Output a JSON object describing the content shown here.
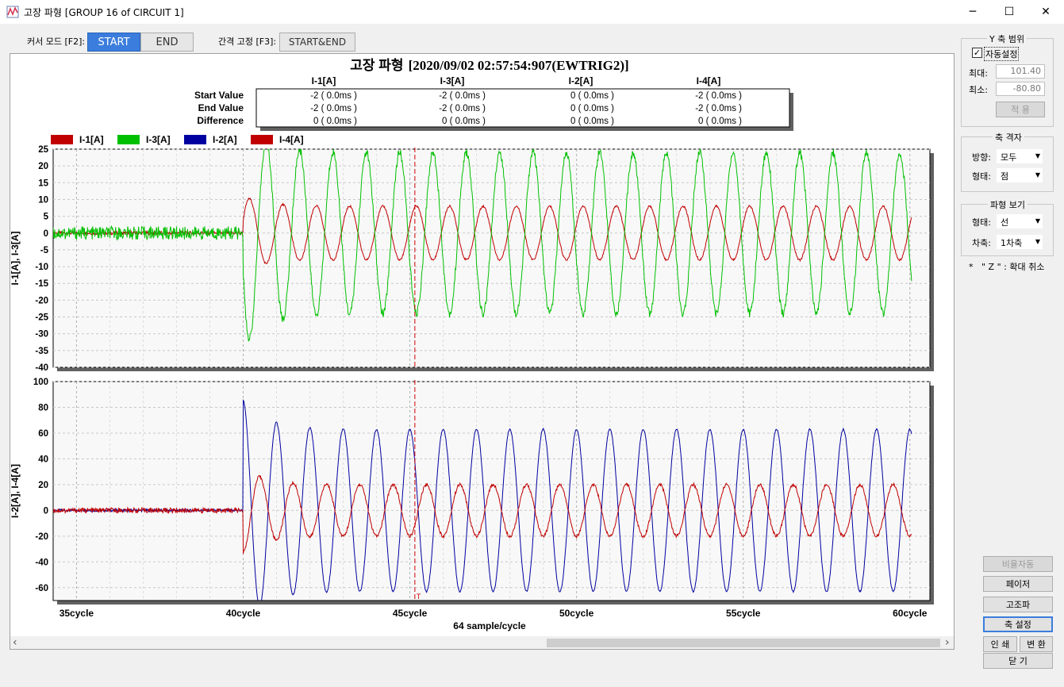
{
  "window": {
    "title": "고장 파형 [GROUP 16 of CIRCUIT 1]",
    "minimize": "─",
    "maximize": "☐",
    "close": "✕"
  },
  "toolbar": {
    "cursor_mode_label": "커서 모드 [F2]:",
    "start_label": "START",
    "end_label": "END",
    "interval_label": "간격 고정 [F3]:",
    "startend_label": "START&END"
  },
  "chart_header": {
    "title": "고장 파형",
    "timestamp": "[2020/09/02 02:57:54:907(EWTRIG2)]",
    "columns": [
      "I-1[A]",
      "I-3[A]",
      "I-2[A]",
      "I-4[A]"
    ],
    "rows": [
      {
        "label": "Start Value",
        "cells": [
          "-2 (   0.0ms )",
          "-2 (   0.0ms )",
          "0 (   0.0ms )",
          "-2 (   0.0ms )"
        ]
      },
      {
        "label": "End Value",
        "cells": [
          "-2 (   0.0ms )",
          "-2 (   0.0ms )",
          "0 (   0.0ms )",
          "-2 (   0.0ms )"
        ]
      },
      {
        "label": "Difference",
        "cells": [
          "0 (   0.0ms )",
          "0 (   0.0ms )",
          "0 (   0.0ms )",
          "0 (   0.0ms )"
        ]
      }
    ]
  },
  "chart_data": [
    {
      "type": "line",
      "ylabel": "I-1[A], I-3[A]",
      "ylim": [
        -40,
        25
      ],
      "yticks": [
        25,
        20,
        15,
        10,
        5,
        0,
        -5,
        -10,
        -15,
        -20,
        -25,
        -30,
        -35,
        -40
      ],
      "xlim": [
        34.3,
        60.6
      ],
      "x_ticks": [
        35,
        40,
        45,
        50,
        55,
        60
      ],
      "x_tick_labels": [
        "35cycle",
        "40cycle",
        "45cycle",
        "50cycle",
        "55cycle",
        "60cycle"
      ],
      "fault_start_cycle": 40,
      "cursor_cycle": 45.15,
      "grid": true,
      "legend_position": "top-left",
      "series": [
        {
          "name": "I-1[A]",
          "color": "#c00000",
          "pre_fault_amplitude": 0.5,
          "fault_amplitude": 8,
          "first_peak": 11,
          "phase_deg": 20
        },
        {
          "name": "I-3[A]",
          "color": "#00c000",
          "pre_fault_amplitude": 2,
          "fault_amplitude": 24,
          "first_peak": -34,
          "phase_deg": 200
        }
      ]
    },
    {
      "type": "line",
      "ylabel": "I-2[A], I-4[A]",
      "ylim": [
        -70,
        100
      ],
      "yticks": [
        100,
        80,
        60,
        40,
        20,
        0,
        -20,
        -40,
        -60
      ],
      "xlim": [
        34.3,
        60.6
      ],
      "x_ticks": [
        35,
        40,
        45,
        50,
        55,
        60
      ],
      "x_tick_labels": [
        "35cycle",
        "40cycle",
        "45cycle",
        "50cycle",
        "55cycle",
        "60cycle"
      ],
      "fault_start_cycle": 40,
      "cursor_cycle": 45.15,
      "cursor_marker": "T",
      "grid": true,
      "series": [
        {
          "name": "I-2[A]",
          "color": "#0000a0",
          "pre_fault_amplitude": 1,
          "fault_amplitude": 63,
          "first_peak": 86,
          "phase_deg": 90
        },
        {
          "name": "I-4[A]",
          "color": "#c00000",
          "pre_fault_amplitude": 2,
          "fault_amplitude": 20,
          "first_peak": -33,
          "phase_deg": 270
        }
      ]
    }
  ],
  "xaxis_title": "64 sample/cycle",
  "colors": {
    "accent": "#3b7ddd",
    "plot_bg": "#f8f8f8",
    "cursor": "#d00000"
  },
  "sidebar": {
    "y_range": {
      "title": "Y 축 범위",
      "auto_label": "자동설정",
      "auto_checked": true,
      "max_label": "최대:",
      "max_value": "101.40",
      "min_label": "최소:",
      "min_value": "-80.80",
      "apply_label": "적 용"
    },
    "axis_grid": {
      "title": "축 격자",
      "direction_label": "방향:",
      "direction_value": "모두",
      "shape_label": "형태:",
      "shape_value": "점"
    },
    "wave_view": {
      "title": "파형 보기",
      "shape_label": "형태:",
      "shape_value": "선",
      "order_label": "차축:",
      "order_value": "1차축"
    },
    "zoom_hint": "*   \" Z \" : 확대 취소",
    "buttons": {
      "ratio_auto": "비율자동",
      "phasor": "페이저",
      "harmonic": "고조파",
      "axis_settings": "축 설정",
      "print": "인 쇄",
      "convert": "변 환",
      "close": "닫   기"
    }
  },
  "scroll": {
    "left_arrow": "‹",
    "right_arrow": "›"
  }
}
